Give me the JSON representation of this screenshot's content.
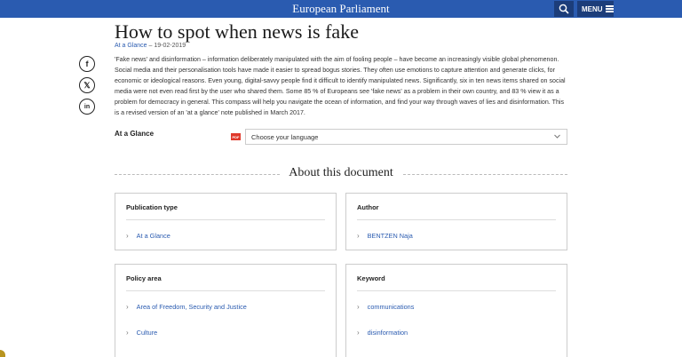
{
  "header": {
    "site_title": "European Parliament",
    "menu_label": "MENU"
  },
  "article": {
    "title": "How to spot when news is fake",
    "type_link": "At a Glance",
    "date": "– 19-02-2019",
    "summary": "'Fake news' and disinformation – information deliberately manipulated with the aim of fooling people – have become an increasingly visible global phenomenon. Social media and their personalisation tools have made it easier to spread bogus stories. They often use emotions to capture attention and generate clicks, for economic or ideological reasons. Even young, digital-savvy people find it difficult to identify manipulated news. Significantly, six in ten news items shared on social media were not even read first by the user who shared them. Some 85 % of Europeans see 'fake news' as a problem in their own country, and 83 % view it as a problem for democracy in general. This compass will help you navigate the ocean of information, and find your way through waves of lies and disinformation. This is a revised version of an 'at a glance' note published in March 2017."
  },
  "social": [
    {
      "name": "facebook",
      "glyph": "f"
    },
    {
      "name": "x",
      "glyph": "𝕏"
    },
    {
      "name": "linkedin",
      "glyph": "in"
    }
  ],
  "download": {
    "label": "At a Glance",
    "pdf_badge": "PDF",
    "language_placeholder": "Choose your language"
  },
  "about": {
    "title": "About this document",
    "cards": {
      "publication_type": {
        "title": "Publication type",
        "items": [
          "At a Glance"
        ]
      },
      "author": {
        "title": "Author",
        "items": [
          "BENTZEN Naja"
        ]
      },
      "policy_area": {
        "title": "Policy area",
        "items": [
          "Area of Freedom, Security and Justice",
          "Culture"
        ]
      },
      "keyword": {
        "title": "Keyword",
        "items": [
          "communications",
          "disinformation"
        ]
      }
    }
  },
  "colors": {
    "brand_blue": "#2a5bb0",
    "dark_blue": "#1c3d7a",
    "pdf_red": "#e03a2c"
  }
}
